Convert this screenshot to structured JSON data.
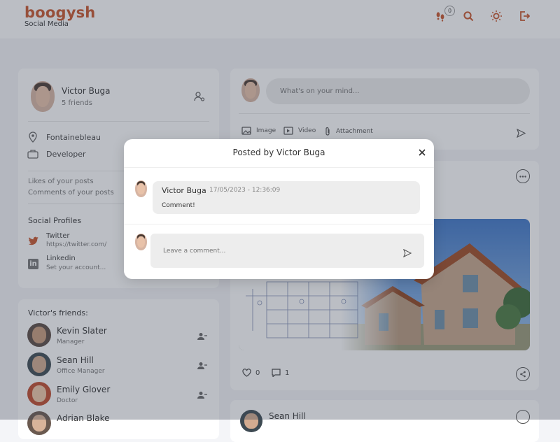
{
  "header": {
    "brand": "boogysh",
    "subtitle": "Social Media",
    "notification_count": "0",
    "icons": [
      "footsteps-icon",
      "search-icon",
      "sun-icon",
      "logout-icon"
    ]
  },
  "profile": {
    "name": "Victor Buga",
    "friends_count": "5 friends",
    "location": "Fontainebleau",
    "occupation": "Developer",
    "likes_label": "Likes of your posts",
    "comments_label": "Comments of your posts",
    "social_title": "Social Profiles",
    "social": [
      {
        "name": "Twitter",
        "value": "https://twitter.com/"
      },
      {
        "name": "Linkedin",
        "value": "Set your account..."
      }
    ]
  },
  "friends": {
    "title": "Victor's friends:",
    "items": [
      {
        "name": "Kevin Slater",
        "role": "Manager"
      },
      {
        "name": "Sean Hill",
        "role": "Office Manager"
      },
      {
        "name": "Emily Glover",
        "role": "Doctor"
      },
      {
        "name": "Adrian Blake",
        "role": ""
      }
    ]
  },
  "composer": {
    "placeholder": "What's on your mind...",
    "image_label": "Image",
    "video_label": "Video",
    "attachment_label": "Attachment"
  },
  "post": {
    "likes": "0",
    "comments": "1"
  },
  "next_post": {
    "author": "Sean Hill"
  },
  "modal": {
    "title": "Posted by Victor Buga",
    "comment": {
      "author": "Victor Buga",
      "timestamp": "17/05/2023 - 12:36:09",
      "text": "Comment!"
    },
    "input_placeholder": "Leave a comment..."
  },
  "colors": {
    "brand": "#c8552b",
    "overlay": "#3c4455"
  }
}
